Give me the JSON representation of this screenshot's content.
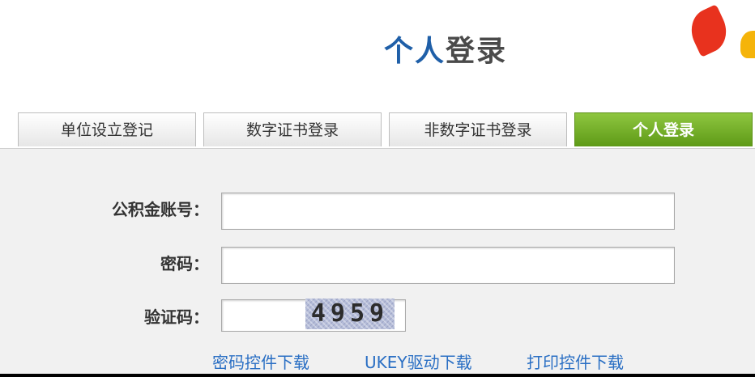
{
  "page": {
    "title_part1": "个人",
    "title_part2": "登录"
  },
  "tabs": [
    {
      "label": "单位设立登记",
      "active": false
    },
    {
      "label": "数字证书登录",
      "active": false
    },
    {
      "label": "非数字证书登录",
      "active": false
    },
    {
      "label": "个人登录",
      "active": true
    }
  ],
  "form": {
    "account_label": "公积金账号：",
    "account_value": "",
    "password_label": "密码：",
    "password_value": "",
    "captcha_label": "验证码：",
    "captcha_value": "",
    "captcha_code": "4959"
  },
  "links": {
    "password_control": "密码控件下载",
    "ukey_driver": "UKEY驱动下载",
    "print_control": "打印控件下载"
  },
  "colors": {
    "accent_green": "#6aa820",
    "title_blue": "#1f5fa8",
    "link_blue": "#2a6fc4"
  }
}
